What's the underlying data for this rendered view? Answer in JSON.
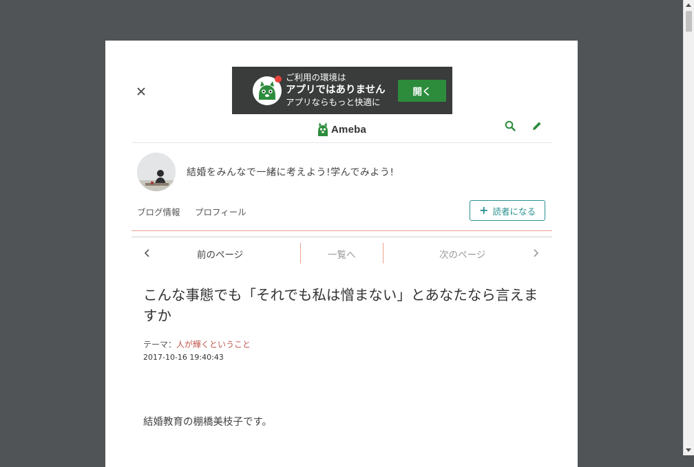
{
  "banner": {
    "line1": "ご利用の環境は",
    "line2": "アプリではありません",
    "line3": "アプリならもっと快適に",
    "open_label": "開く"
  },
  "header": {
    "logo_text": "Ameba"
  },
  "blog": {
    "title": "結婚をみんなで一緒に考えよう!学んでみよう!",
    "nav": [
      "ブログ情報",
      "プロフィール"
    ],
    "reader_button": "読者になる"
  },
  "pager": {
    "prev_label": "前のページ",
    "list_label": "一覧へ",
    "next_label": "次のページ"
  },
  "entry": {
    "title": "こんな事態でも「それでも私は憎まない」とあなたなら言えますか",
    "theme_label": "テーマ：",
    "theme_value": "人が輝くということ",
    "date": "2017-10-16 19:40:43",
    "body_first_line": "結婚教育の棚橋美枝子です。"
  },
  "colors": {
    "ameba_green": "#2d8c3c",
    "reader_teal": "#2a8f8f",
    "accent_salmon": "#e9a18a",
    "theme_link": "#c0574b"
  }
}
